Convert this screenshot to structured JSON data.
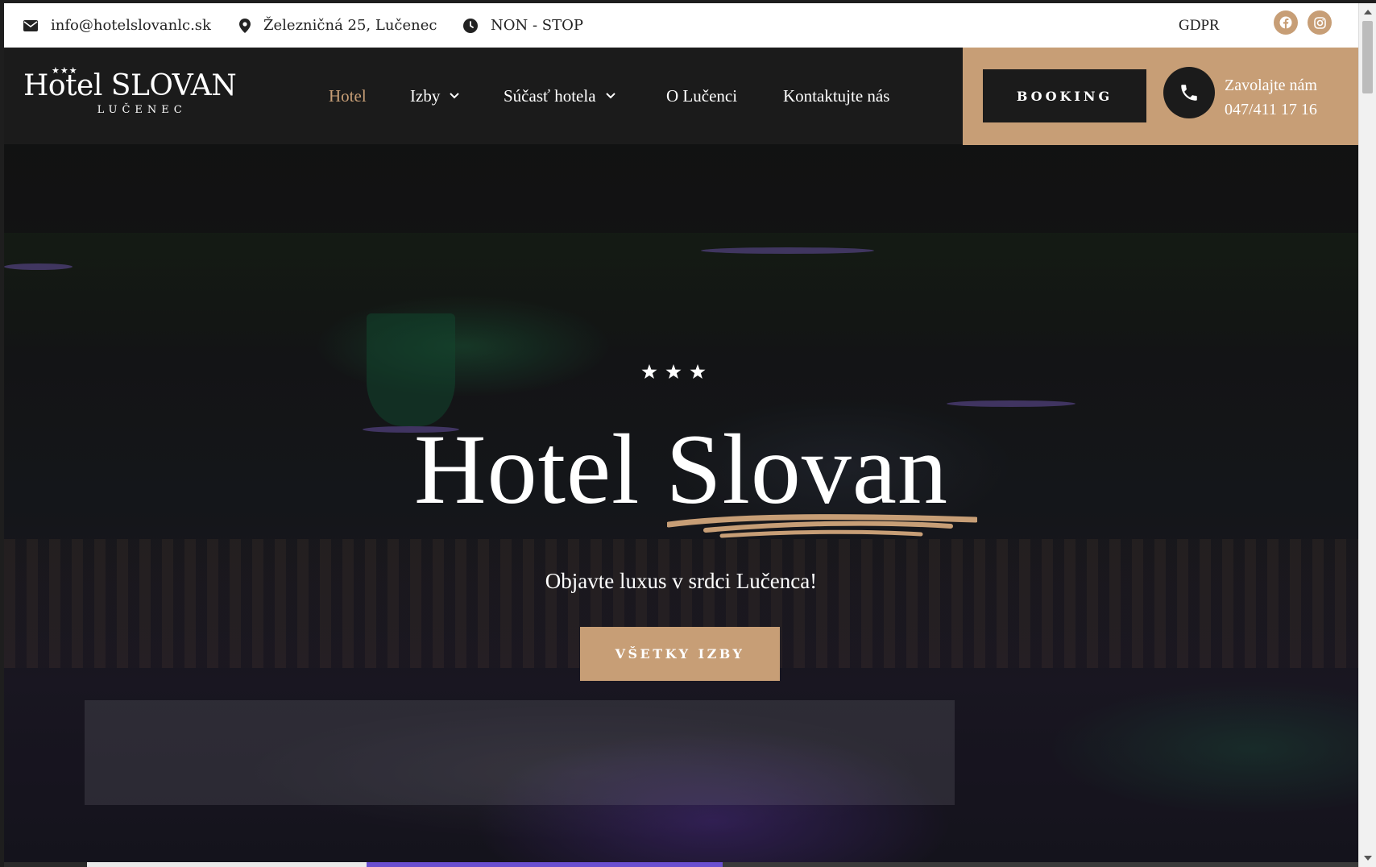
{
  "topbar": {
    "email": "info@hotelslovanlc.sk",
    "address": "Železničná 25, Lučenec",
    "hours": "NON - STOP",
    "gdpr": "GDPR",
    "icons": {
      "email": "envelope-icon",
      "address": "map-pin-icon",
      "hours": "clock-icon",
      "facebook": "facebook-icon",
      "instagram": "instagram-icon"
    }
  },
  "logo": {
    "main": "Hotel SLOVAN",
    "stars": "★★★",
    "sub": "LUČENEC"
  },
  "nav": {
    "items": [
      {
        "label": "Hotel",
        "active": true
      },
      {
        "label": "Izby",
        "dropdown": true
      },
      {
        "label": "Súčasť hotela",
        "dropdown": true
      },
      {
        "label": "O Lučenci"
      },
      {
        "label": "Kontaktujte nás"
      }
    ]
  },
  "cta": {
    "booking": "BOOKING",
    "call_label": "Zavolajte nám",
    "phone": "047/411 17 16"
  },
  "hero": {
    "stars": 3,
    "title": "Hotel Slovan",
    "subtitle": "Objavte luxus v srdci Lučenca!",
    "button": "VŠETKY IZBY"
  },
  "colors": {
    "accent": "#c79e76",
    "dark": "#1b1b1b",
    "white": "#ffffff"
  }
}
